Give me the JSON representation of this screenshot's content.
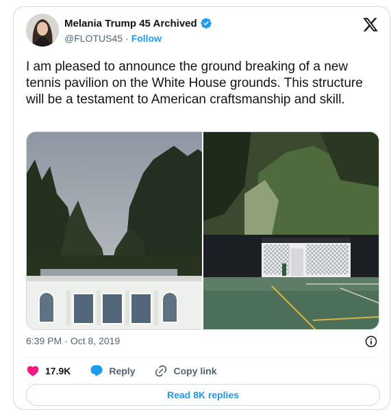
{
  "author": {
    "display_name": "Melania Trump 45 Archived",
    "handle": "@FLOTUS45",
    "separator": "·",
    "follow_label": "Follow"
  },
  "tweet": {
    "text": "I am pleased to announce the ground breaking of a new tennis pavilion on the White House grounds. This structure will be a testament to American craftsmanship and skill."
  },
  "meta": {
    "time": "6:39 PM",
    "separator": "·",
    "date": "Oct 8, 2019"
  },
  "actions": {
    "like_count": "17.9K",
    "reply_label": "Reply",
    "copy_link_label": "Copy link"
  },
  "replies": {
    "label": "Read 8K replies"
  },
  "icons": {
    "verified": "verified-badge-icon",
    "platform": "x-logo-icon",
    "info": "info-icon",
    "like": "heart-icon",
    "reply": "reply-bubble-icon",
    "copy": "link-icon"
  },
  "colors": {
    "accent": "#1d9bf0",
    "like": "#f91880",
    "muted": "#536471",
    "border": "#cfd9de"
  }
}
